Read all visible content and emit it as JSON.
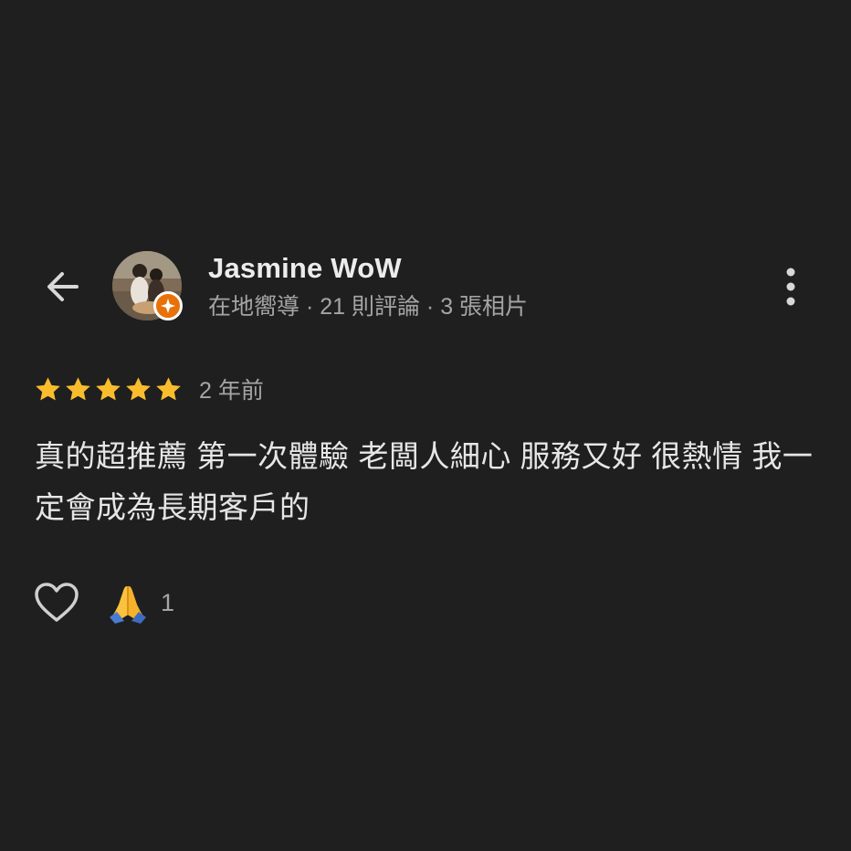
{
  "reviewer": {
    "name": "Jasmine WoW",
    "meta": "在地嚮導 · 21 則評論 · 3 張相片",
    "badge_color": "#e8710a"
  },
  "rating": {
    "stars": 5,
    "max_stars": 5,
    "star_color": "#f9bc2c",
    "time": "2 年前"
  },
  "review": {
    "text": "真的超推薦 第一次體驗 老闆人細心 服務又好 很熱情 我一定會成為長期客戶的"
  },
  "reactions": {
    "like_icon": "heart-outline-icon",
    "emoji_icon": "folded-hands-icon",
    "emoji_count": "1"
  },
  "icons": {
    "back": "arrow-left-icon",
    "more": "more-vertical-icon"
  }
}
